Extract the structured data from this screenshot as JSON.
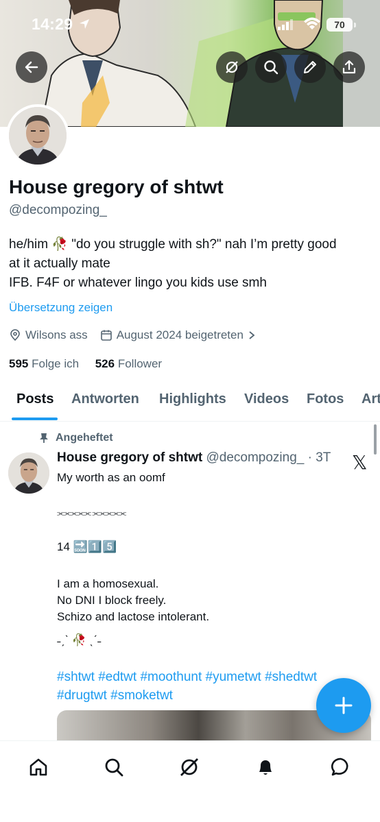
{
  "status_bar": {
    "time": "14:29",
    "battery": "70"
  },
  "profile": {
    "name": "House gregory of shtwt",
    "handle": "@decompozing_",
    "bio_lines": [
      "he/him 🥀 \"do you struggle with sh?\" nah I’m pretty good",
      "at it actually mate",
      "IFB. F4F or whatever lingo you kids use smh"
    ],
    "translate_label": "Übersetzung zeigen",
    "location": "Wilsons ass",
    "joined": "August 2024 beigetreten",
    "following_count": "595",
    "following_label": "Folge ich",
    "followers_count": "526",
    "followers_label": "Follower"
  },
  "tabs": [
    "Posts",
    "Antworten",
    "Highlights",
    "Videos",
    "Fotos",
    "Art"
  ],
  "pinned_post": {
    "pinned_label": "Angeheftet",
    "author_name": "House gregory of shtwt",
    "author_handle": "@decompozing_",
    "age": "· 3T",
    "lines": {
      "l1": "My worth as an oomf",
      "l2": "⫘⫘⫘⫘⫘ ⫘⫘⫘⫘⫘",
      "l3": "14 🔜1️⃣5️⃣",
      "l4": "I am a homosexual.",
      "l5": "No DNI I block freely.",
      "l6": "Schizo and lactose intolerant.",
      "l7": "˗ˏˋ 🥀 ˎˊ˗"
    },
    "hashtags": "#shtwt #edtwt #moothunt #yumetwt #shedtwt #drugtwt #smoketwt"
  },
  "icons": {
    "back": "arrow-left-icon",
    "grok": "grok-icon",
    "search": "search-icon",
    "edit": "pencil-icon",
    "share": "share-icon",
    "compose": "plus-icon"
  },
  "colors": {
    "accent": "#1d9bf0",
    "text": "#0f1419",
    "secondary": "#536471"
  }
}
